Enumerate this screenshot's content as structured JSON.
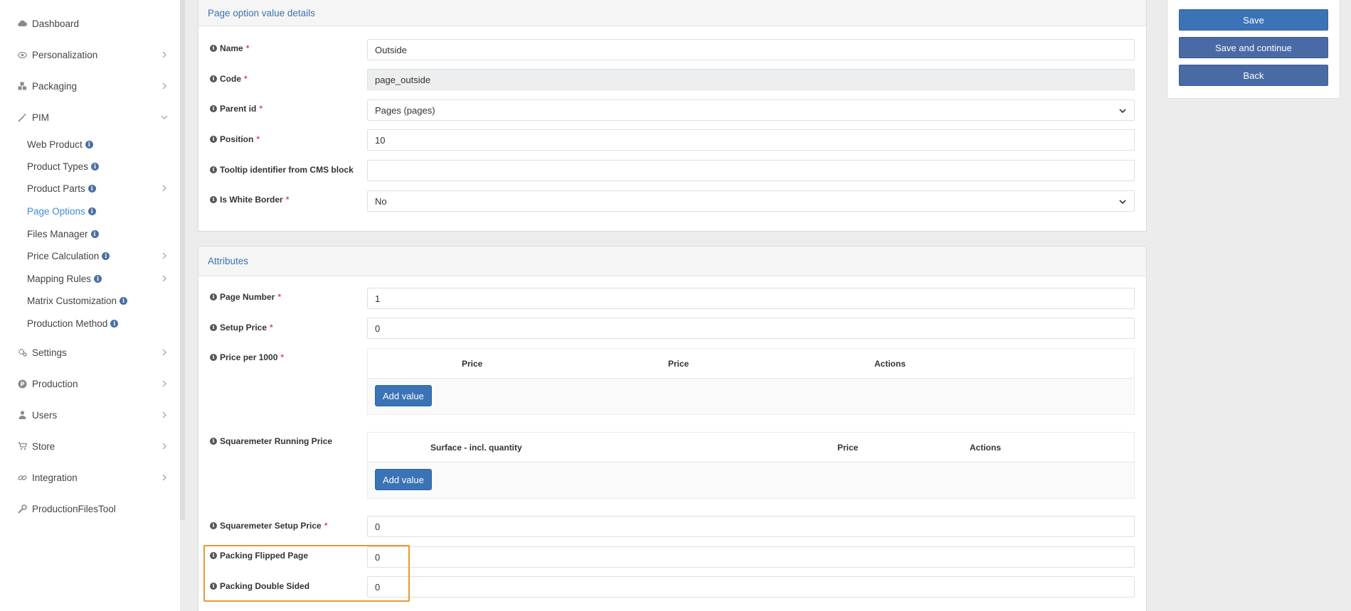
{
  "sidebar": {
    "items": [
      {
        "label": "Dashboard",
        "icon": "cloud-icon"
      },
      {
        "label": "Personalization",
        "icon": "eye-icon"
      },
      {
        "label": "Packaging",
        "icon": "cubes-icon"
      },
      {
        "label": "PIM",
        "icon": "magic-wand-icon"
      }
    ],
    "pim_sub": [
      {
        "label": "Web Product"
      },
      {
        "label": "Product Types"
      },
      {
        "label": "Product Parts"
      },
      {
        "label": "Page Options"
      },
      {
        "label": "Files Manager"
      },
      {
        "label": "Price Calculation"
      },
      {
        "label": "Mapping Rules"
      },
      {
        "label": "Matrix Customization"
      },
      {
        "label": "Production Method"
      }
    ],
    "bottom_items": [
      {
        "label": "Settings",
        "icon": "cogs-icon"
      },
      {
        "label": "Production",
        "icon": "production-icon"
      },
      {
        "label": "Users",
        "icon": "user-icon"
      },
      {
        "label": "Store",
        "icon": "cart-icon"
      },
      {
        "label": "Integration",
        "icon": "link-icon"
      },
      {
        "label": "ProductionFilesTool",
        "icon": "wrench-icon"
      }
    ]
  },
  "details": {
    "title": "Page option value details",
    "name_label": "Name",
    "name_value": "Outside",
    "code_label": "Code",
    "code_value": "page_outside",
    "parent_label": "Parent id",
    "parent_value": "Pages (pages)",
    "position_label": "Position",
    "position_value": "10",
    "tooltip_label": "Tooltip identifier from CMS block",
    "tooltip_value": "",
    "white_border_label": "Is White Border",
    "white_border_value": "No"
  },
  "attributes": {
    "title": "Attributes",
    "page_number_label": "Page Number",
    "page_number_value": "1",
    "setup_price_label": "Setup Price",
    "setup_price_value": "0",
    "price1000_label": "Price per 1000",
    "price1000_cols": [
      "Price",
      "Price",
      "Actions"
    ],
    "add_value": "Add value",
    "sqm_running_label": "Squaremeter Running Price",
    "sqm_running_cols": [
      "Surface - incl. quantity",
      "Price",
      "Actions"
    ],
    "sqm_setup_label": "Squaremeter Setup Price",
    "sqm_setup_value": "0",
    "flipped_label": "Packing Flipped Page",
    "flipped_value": "0",
    "double_label": "Packing Double Sided",
    "double_value": "0"
  },
  "actions": {
    "save": "Save",
    "save_continue": "Save and continue",
    "back": "Back"
  },
  "colors": {
    "accent": "#3a73b6",
    "active_link": "#3f8bd4",
    "highlight": "#e39a3c"
  }
}
